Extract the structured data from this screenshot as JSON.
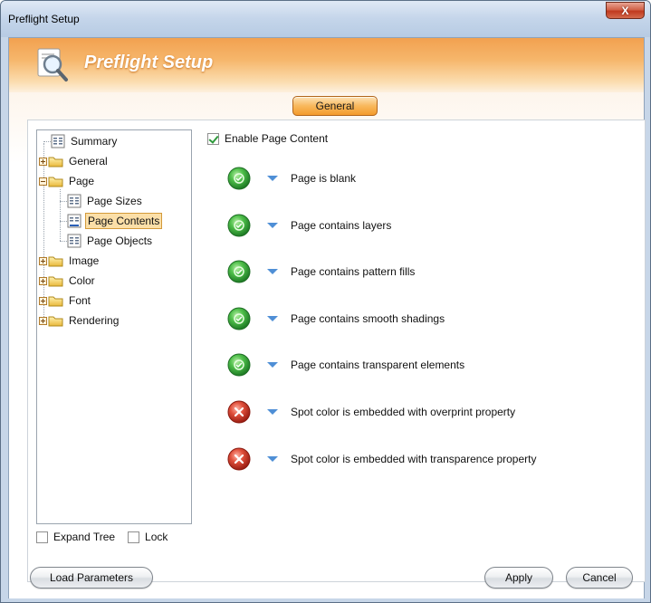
{
  "window": {
    "title": "Preflight Setup",
    "close_label": "X"
  },
  "banner": {
    "title": "Preflight Setup"
  },
  "tab": {
    "label": "General"
  },
  "tree": {
    "items": [
      {
        "label": "Summary",
        "kind": "doc"
      },
      {
        "label": "General",
        "kind": "folder"
      },
      {
        "label": "Page",
        "kind": "folder"
      },
      {
        "label": "Page Sizes",
        "kind": "doc"
      },
      {
        "label": "Page Contents",
        "kind": "doc",
        "selected": true
      },
      {
        "label": "Page Objects",
        "kind": "doc"
      },
      {
        "label": "Image",
        "kind": "folder"
      },
      {
        "label": "Color",
        "kind": "folder"
      },
      {
        "label": "Font",
        "kind": "folder"
      },
      {
        "label": "Rendering",
        "kind": "folder"
      }
    ]
  },
  "enable": {
    "label": "Enable Page Content",
    "checked": true
  },
  "rules": [
    {
      "label": "Page is blank",
      "status": "pass"
    },
    {
      "label": "Page contains layers",
      "status": "pass"
    },
    {
      "label": "Page contains pattern fills",
      "status": "pass"
    },
    {
      "label": "Page contains smooth shadings",
      "status": "pass"
    },
    {
      "label": "Page contains transparent elements",
      "status": "pass"
    },
    {
      "label": "Spot color is embedded with overprint property",
      "status": "fail"
    },
    {
      "label": "Spot color is embedded with transparence property",
      "status": "fail"
    }
  ],
  "options": {
    "expand_tree": "Expand Tree",
    "lock": "Lock"
  },
  "buttons": {
    "load": "Load Parameters",
    "apply": "Apply",
    "cancel": "Cancel"
  },
  "colors": {
    "accent": "#f49a2c",
    "pass": "#3aa845",
    "fail": "#d23b2b",
    "arrow": "#4f8fd6"
  }
}
